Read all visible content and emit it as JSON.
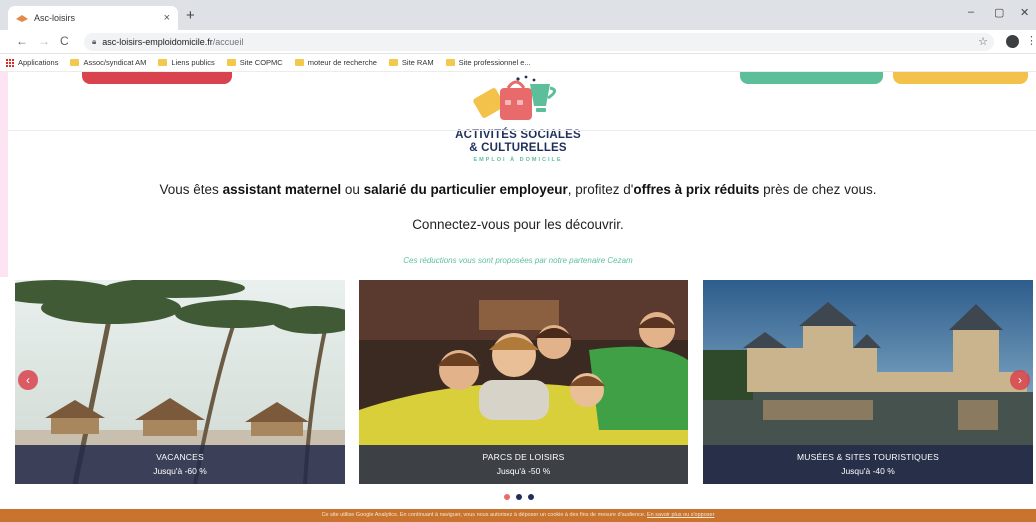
{
  "browser": {
    "tab_title": "Asc-loisirs",
    "tab_close": "×",
    "new_tab": "+",
    "url_host": "asc-loisirs-emploidomicile.fr",
    "url_path": "/accueil",
    "window_minimize": "–",
    "window_restore": "▢",
    "window_close": "✕",
    "bookmarks": [
      {
        "label": "Applications",
        "icon": "apps-grid-icon"
      },
      {
        "label": "Assoc/syndicat AM",
        "icon": "folder-icon"
      },
      {
        "label": "Liens publics",
        "icon": "folder-icon"
      },
      {
        "label": "Site COPMC",
        "icon": "folder-icon"
      },
      {
        "label": "moteur de recherche",
        "icon": "folder-icon"
      },
      {
        "label": "Site RAM",
        "icon": "folder-icon"
      },
      {
        "label": "Site professionnel e...",
        "icon": "folder-icon"
      }
    ]
  },
  "logo": {
    "line1": "ACTIVITÉS SOCIALES",
    "line2": "& CULTURELLES",
    "tagline": "EMPLOI À DOMICILE"
  },
  "intro": {
    "p1": "Vous êtes ",
    "b1": "assistant maternel",
    "p2": " ou ",
    "b2": "salarié du particulier employeur",
    "p3": ", profitez d'",
    "b3": "offres à prix réduits",
    "p4": " près de chez vous.",
    "connect": "Connectez-vous pour les découvrir.",
    "partner": "Ces réductions vous sont proposées par notre partenaire Cezam"
  },
  "carousel": {
    "prev": "‹",
    "next": "›",
    "cards": [
      {
        "title": "VACANCES",
        "subtitle": "Jusqu'à -60 %"
      },
      {
        "title": "PARCS DE LOISIRS",
        "subtitle": "Jusqu'à -50 %"
      },
      {
        "title": "MUSÉES & SITES TOURISTIQUES",
        "subtitle": "Jusqu'à -40 %"
      }
    ],
    "dots": 3,
    "active_dot": 0
  },
  "cookie_banner": {
    "text": "Ce site utilise Google Analytics. En continuant à naviguer, vous nous autorisez à déposer un cookie à des fins de mesure d'audience. ",
    "link": "En savoir plus ou s'opposer"
  },
  "colors": {
    "navy": "#1f2e5c",
    "green": "#5cbf9a",
    "red": "#d9434e",
    "yellow": "#f3c24b",
    "cookie_bar": "#c9742e"
  }
}
